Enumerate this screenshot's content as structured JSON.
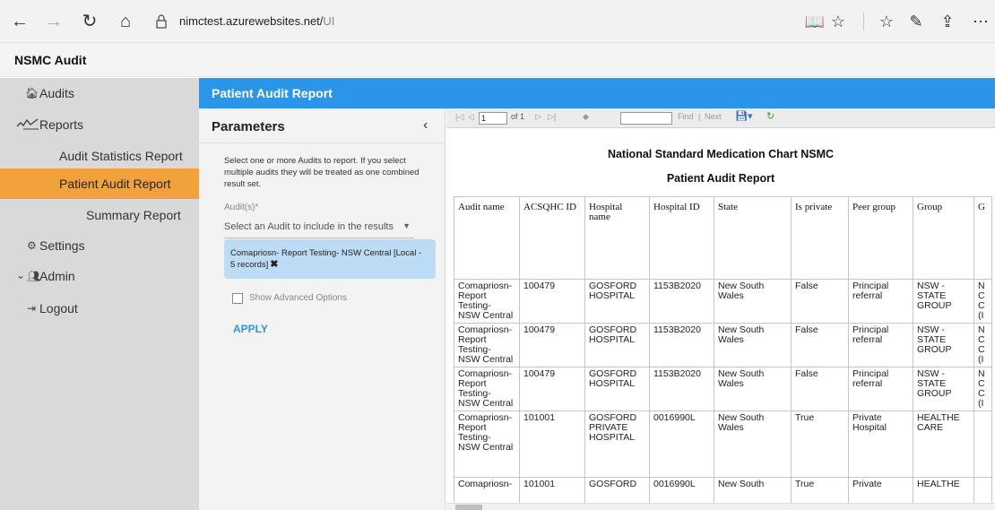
{
  "browser": {
    "url_host": "nimctest.azurewebsites.net/",
    "url_path": "UI"
  },
  "app": {
    "title": "NSMC Audit"
  },
  "sidebar": {
    "items": [
      {
        "label": "Audits",
        "icon": "home-icon"
      },
      {
        "label": "Reports",
        "icon": "chart-line-icon"
      },
      {
        "label": "Audit Statistics Report"
      },
      {
        "label": "Patient Audit Report",
        "active": true
      },
      {
        "label": "Summary Report"
      },
      {
        "label": "Settings",
        "icon": "gears-icon"
      },
      {
        "label": "Admin",
        "icon": "users-icon"
      },
      {
        "label": "Logout",
        "icon": "sign-out-icon"
      }
    ]
  },
  "page": {
    "title": "Patient Audit Report"
  },
  "params": {
    "title": "Parameters",
    "description": "Select one or more Audits to report. If you select multiple audits they will be treated as one combined result set.",
    "audit_label": "Audit(s)*",
    "audit_placeholder": "Select an Audit to include in the results",
    "selected_chip": "Comapriosn- Report Testing- NSW Central [Local - 5 records]",
    "advanced_label": "Show Advanced Options",
    "apply_label": "APPLY"
  },
  "viewer": {
    "toolbar": {
      "page_value": "1",
      "page_of": "of 1",
      "find_label": "Find",
      "next_label": "Next",
      "separator": "|"
    },
    "title1": "National Standard Medication Chart NSMC",
    "title2": "Patient Audit Report",
    "columns": [
      "Audit name",
      "ACSQHC ID",
      "Hospital name",
      "Hospital ID",
      "State",
      "Is private",
      "Peer group",
      "Group",
      "G"
    ],
    "rows": [
      [
        "Comapriosn- Report Testing- NSW Central",
        "100479",
        "GOSFORD HOSPITAL",
        "1153B2020",
        "New South Wales",
        "False",
        "Principal referral",
        "NSW - STATE GROUP",
        "N C C (I"
      ],
      [
        "Comapriosn- Report Testing- NSW Central",
        "100479",
        "GOSFORD HOSPITAL",
        "1153B2020",
        "New South Wales",
        "False",
        "Principal referral",
        "NSW - STATE GROUP",
        "N C C (I"
      ],
      [
        "Comapriosn- Report Testing- NSW Central",
        "100479",
        "GOSFORD HOSPITAL",
        "1153B2020",
        "New South Wales",
        "False",
        "Principal referral",
        "NSW - STATE GROUP",
        "N C C (I"
      ],
      [
        "Comapriosn- Report Testing- NSW Central",
        "101001",
        "GOSFORD PRIVATE HOSPITAL",
        "0016990L",
        "New South Wales",
        "True",
        "Private Hospital",
        "HEALTHE CARE",
        ""
      ],
      [
        "Comapriosn-",
        "101001",
        "GOSFORD",
        "0016990L",
        "New South",
        "True",
        "Private",
        "HEALTHE",
        ""
      ]
    ]
  },
  "colors": {
    "accent_blue": "#2b95e9",
    "active_orange": "#f2a23b",
    "chip_blue": "#bcdcf5"
  }
}
